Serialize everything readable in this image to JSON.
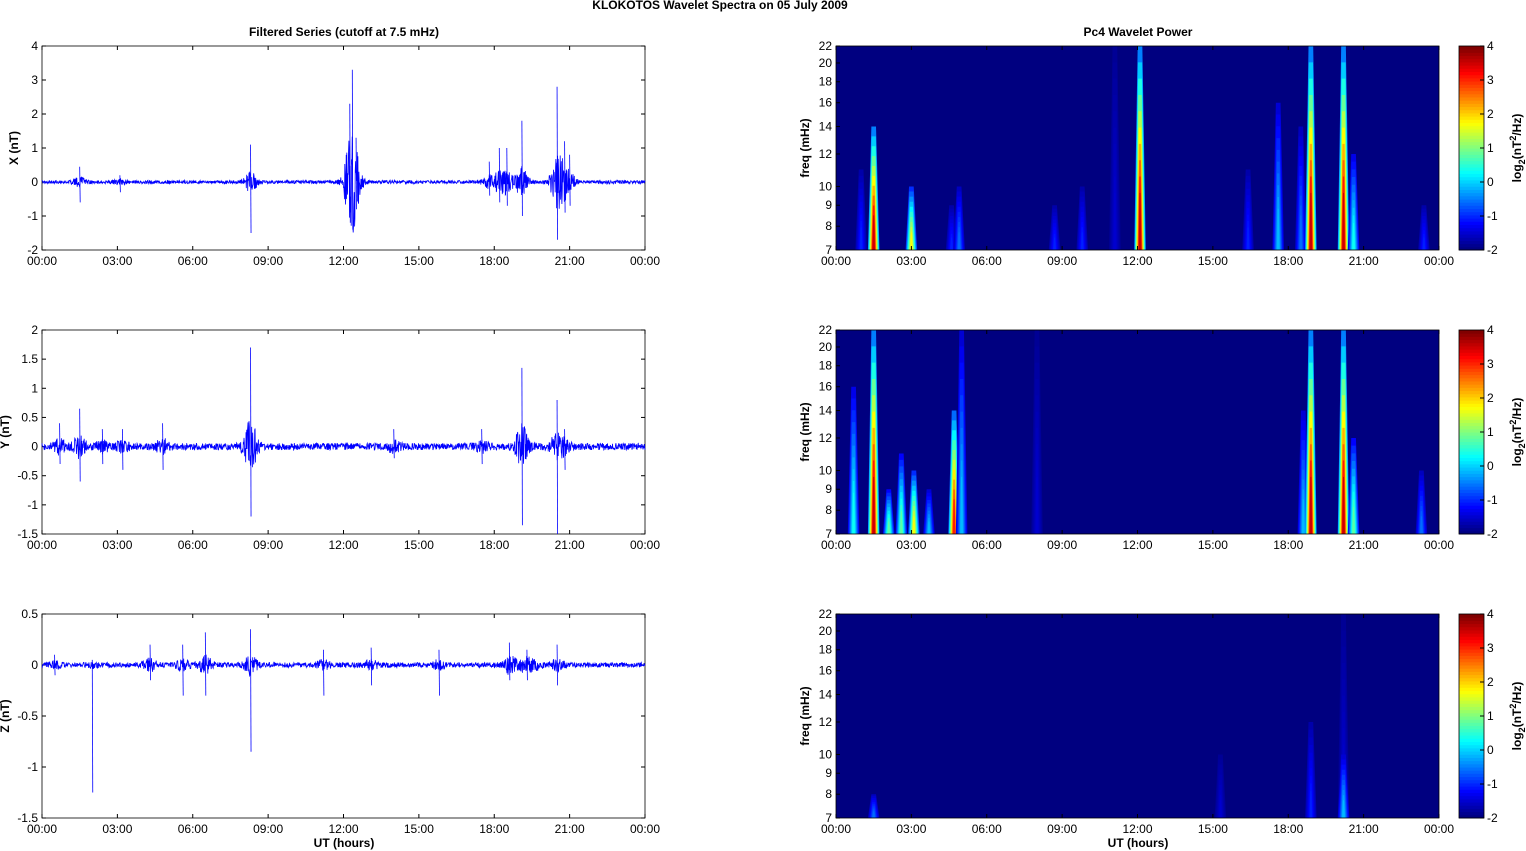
{
  "title": "KLOKOTOS Wavelet Spectra on 05 July      2009",
  "chart_data": {
    "type": "line+heatmap",
    "left_title": "Filtered Series (cutoff at 7.5 mHz)",
    "right_title": "Pc4 Wavelet Power",
    "xlabel": "UT (hours)",
    "x_ticks": [
      "00:00",
      "03:00",
      "06:00",
      "09:00",
      "12:00",
      "15:00",
      "18:00",
      "21:00",
      "00:00"
    ],
    "x_range_hours": [
      0,
      24
    ],
    "series_color": "#0000ff",
    "series": [
      {
        "name": "X",
        "ylabel": "X (nT)",
        "ylim": [
          -2,
          4
        ],
        "yticks": [
          -2,
          -1,
          0,
          1,
          2,
          3,
          4
        ],
        "noise": 0.05,
        "events": [
          [
            1.5,
            0.45,
            -0.6
          ],
          [
            3.1,
            0.2,
            -0.3
          ],
          [
            8.3,
            1.1,
            -1.5
          ],
          [
            12.25,
            2.3,
            -1.2
          ],
          [
            12.35,
            3.3,
            -1.4
          ],
          [
            12.5,
            1.3,
            -0.8
          ],
          [
            17.8,
            0.6,
            -0.4
          ],
          [
            18.2,
            1.0,
            -0.6
          ],
          [
            18.5,
            1.0,
            -0.7
          ],
          [
            19.1,
            1.8,
            -1.0
          ],
          [
            20.5,
            2.8,
            -1.7
          ],
          [
            20.8,
            1.2,
            -0.9
          ],
          [
            21.0,
            0.8,
            -0.7
          ]
        ]
      },
      {
        "name": "Y",
        "ylabel": "Y (nT)",
        "ylim": [
          -1.5,
          2
        ],
        "yticks": [
          -1.5,
          -1,
          -0.5,
          0,
          0.5,
          1,
          1.5,
          2
        ],
        "noise": 0.06,
        "events": [
          [
            0.7,
            0.4,
            -0.3
          ],
          [
            1.5,
            0.65,
            -0.6
          ],
          [
            2.4,
            0.3,
            -0.3
          ],
          [
            3.2,
            0.3,
            -0.4
          ],
          [
            4.8,
            0.4,
            -0.4
          ],
          [
            8.3,
            1.7,
            -1.2
          ],
          [
            14.0,
            0.3,
            -0.2
          ],
          [
            17.5,
            0.3,
            -0.3
          ],
          [
            19.1,
            1.35,
            -1.35
          ],
          [
            20.5,
            0.8,
            -1.5
          ],
          [
            20.8,
            0.3,
            -0.4
          ]
        ]
      },
      {
        "name": "Z",
        "ylabel": "Z (nT)",
        "ylim": [
          -1.5,
          0.5
        ],
        "yticks": [
          -1.5,
          -1,
          -0.5,
          0,
          0.5
        ],
        "noise": 0.025,
        "events": [
          [
            0.5,
            0.1,
            -0.1
          ],
          [
            2.0,
            0.05,
            -1.25
          ],
          [
            4.3,
            0.2,
            -0.15
          ],
          [
            5.6,
            0.2,
            -0.3
          ],
          [
            6.5,
            0.32,
            -0.3
          ],
          [
            8.3,
            0.35,
            -0.85
          ],
          [
            11.2,
            0.15,
            -0.3
          ],
          [
            13.1,
            0.17,
            -0.2
          ],
          [
            15.8,
            0.15,
            -0.3
          ],
          [
            18.6,
            0.22,
            -0.15
          ],
          [
            19.3,
            0.15,
            -0.15
          ],
          [
            20.5,
            0.2,
            -0.2
          ]
        ]
      }
    ],
    "spectra": {
      "ylabel": "freq (mHz)",
      "freq_range": [
        7,
        22
      ],
      "freq_scale": "log",
      "yticks": [
        7,
        8,
        9,
        10,
        12,
        14,
        16,
        18,
        20,
        22
      ],
      "colorbar": {
        "label": "log2(nT^2/Hz)",
        "label_main": "log",
        "label_sub": "2",
        "label_rest": "(nT",
        "label_sup": "2",
        "label_end": "/Hz)",
        "range": [
          -2,
          4
        ],
        "ticks": [
          -2,
          -1,
          0,
          1,
          2,
          3,
          4
        ]
      },
      "panels": [
        {
          "name": "X",
          "blobs": [
            [
              1.0,
              11,
              -1
            ],
            [
              1.5,
              14,
              4
            ],
            [
              3.0,
              10,
              2
            ],
            [
              4.6,
              9,
              -1
            ],
            [
              4.9,
              10,
              -0.5
            ],
            [
              8.7,
              9,
              -1
            ],
            [
              9.8,
              10,
              -1
            ],
            [
              11.1,
              22,
              -1.5
            ],
            [
              12.1,
              22,
              4
            ],
            [
              16.4,
              11,
              -1
            ],
            [
              17.6,
              16,
              0
            ],
            [
              18.5,
              14,
              -0.5
            ],
            [
              18.9,
              22,
              4
            ],
            [
              20.2,
              22,
              4
            ],
            [
              20.6,
              12,
              0.5
            ],
            [
              23.4,
              9,
              -1
            ]
          ]
        },
        {
          "name": "Y",
          "blobs": [
            [
              0.7,
              16,
              0.5
            ],
            [
              1.5,
              22,
              4
            ],
            [
              2.1,
              9,
              1
            ],
            [
              2.6,
              11,
              1
            ],
            [
              3.1,
              10,
              2
            ],
            [
              3.7,
              9,
              0
            ],
            [
              4.7,
              14,
              3.5
            ],
            [
              5.0,
              22,
              0
            ],
            [
              8.0,
              22,
              -1.5
            ],
            [
              18.6,
              14,
              0
            ],
            [
              18.9,
              22,
              4
            ],
            [
              20.2,
              22,
              4
            ],
            [
              20.6,
              12,
              1
            ],
            [
              23.3,
              10,
              -0.5
            ]
          ]
        },
        {
          "name": "Z",
          "blobs": [
            [
              1.5,
              8,
              -0.5
            ],
            [
              15.3,
              10,
              -1.5
            ],
            [
              18.9,
              12,
              -1
            ],
            [
              20.2,
              22,
              -1.5
            ],
            [
              20.2,
              10,
              0
            ]
          ]
        }
      ]
    }
  }
}
